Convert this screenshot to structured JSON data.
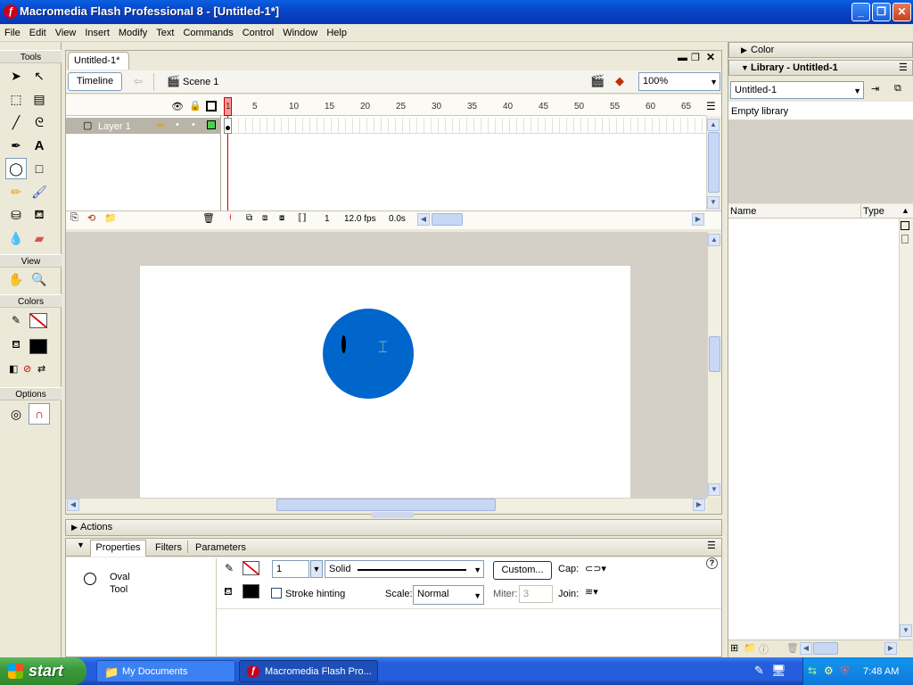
{
  "window": {
    "title": "Macromedia Flash Professional 8 - [Untitled-1*]",
    "app_icon": "flash-icon"
  },
  "menu": [
    "File",
    "Edit",
    "View",
    "Insert",
    "Modify",
    "Text",
    "Commands",
    "Control",
    "Window",
    "Help"
  ],
  "toolbox": {
    "header": "Tools",
    "view_label": "View",
    "colors_label": "Colors",
    "options_label": "Options",
    "selected_tool": "oval-tool"
  },
  "document": {
    "tab": "Untitled-1*",
    "timeline_button": "Timeline",
    "scene": "Scene 1",
    "zoom": "100%"
  },
  "timeline": {
    "layer_name": "Layer 1",
    "ruler": [
      "1",
      "5",
      "10",
      "15",
      "20",
      "25",
      "30",
      "35",
      "40",
      "45",
      "50",
      "55",
      "60",
      "65"
    ],
    "current_frame": "1",
    "fps": "12.0 fps",
    "elapsed": "0.0s"
  },
  "stage": {
    "shape_color": "#0066cc"
  },
  "panels": {
    "actions": "Actions",
    "tabs": [
      "Properties",
      "Filters",
      "Parameters"
    ],
    "tool_name_1": "Oval",
    "tool_name_2": "Tool",
    "stroke_height": "1",
    "stroke_style": "Solid",
    "custom_button": "Custom...",
    "cap_label": "Cap:",
    "stroke_hinting": "Stroke hinting",
    "scale_label": "Scale:",
    "scale_value": "Normal",
    "miter_label": "Miter:",
    "miter_value": "3",
    "join_label": "Join:"
  },
  "right_panels": {
    "color": "Color",
    "library": "Library - Untitled-1",
    "library_select": "Untitled-1",
    "empty": "Empty library",
    "col_name": "Name",
    "col_type": "Type"
  },
  "taskbar": {
    "start": "start",
    "items": [
      "My Documents",
      "Macromedia Flash Pro..."
    ],
    "clock": "7:48 AM"
  }
}
